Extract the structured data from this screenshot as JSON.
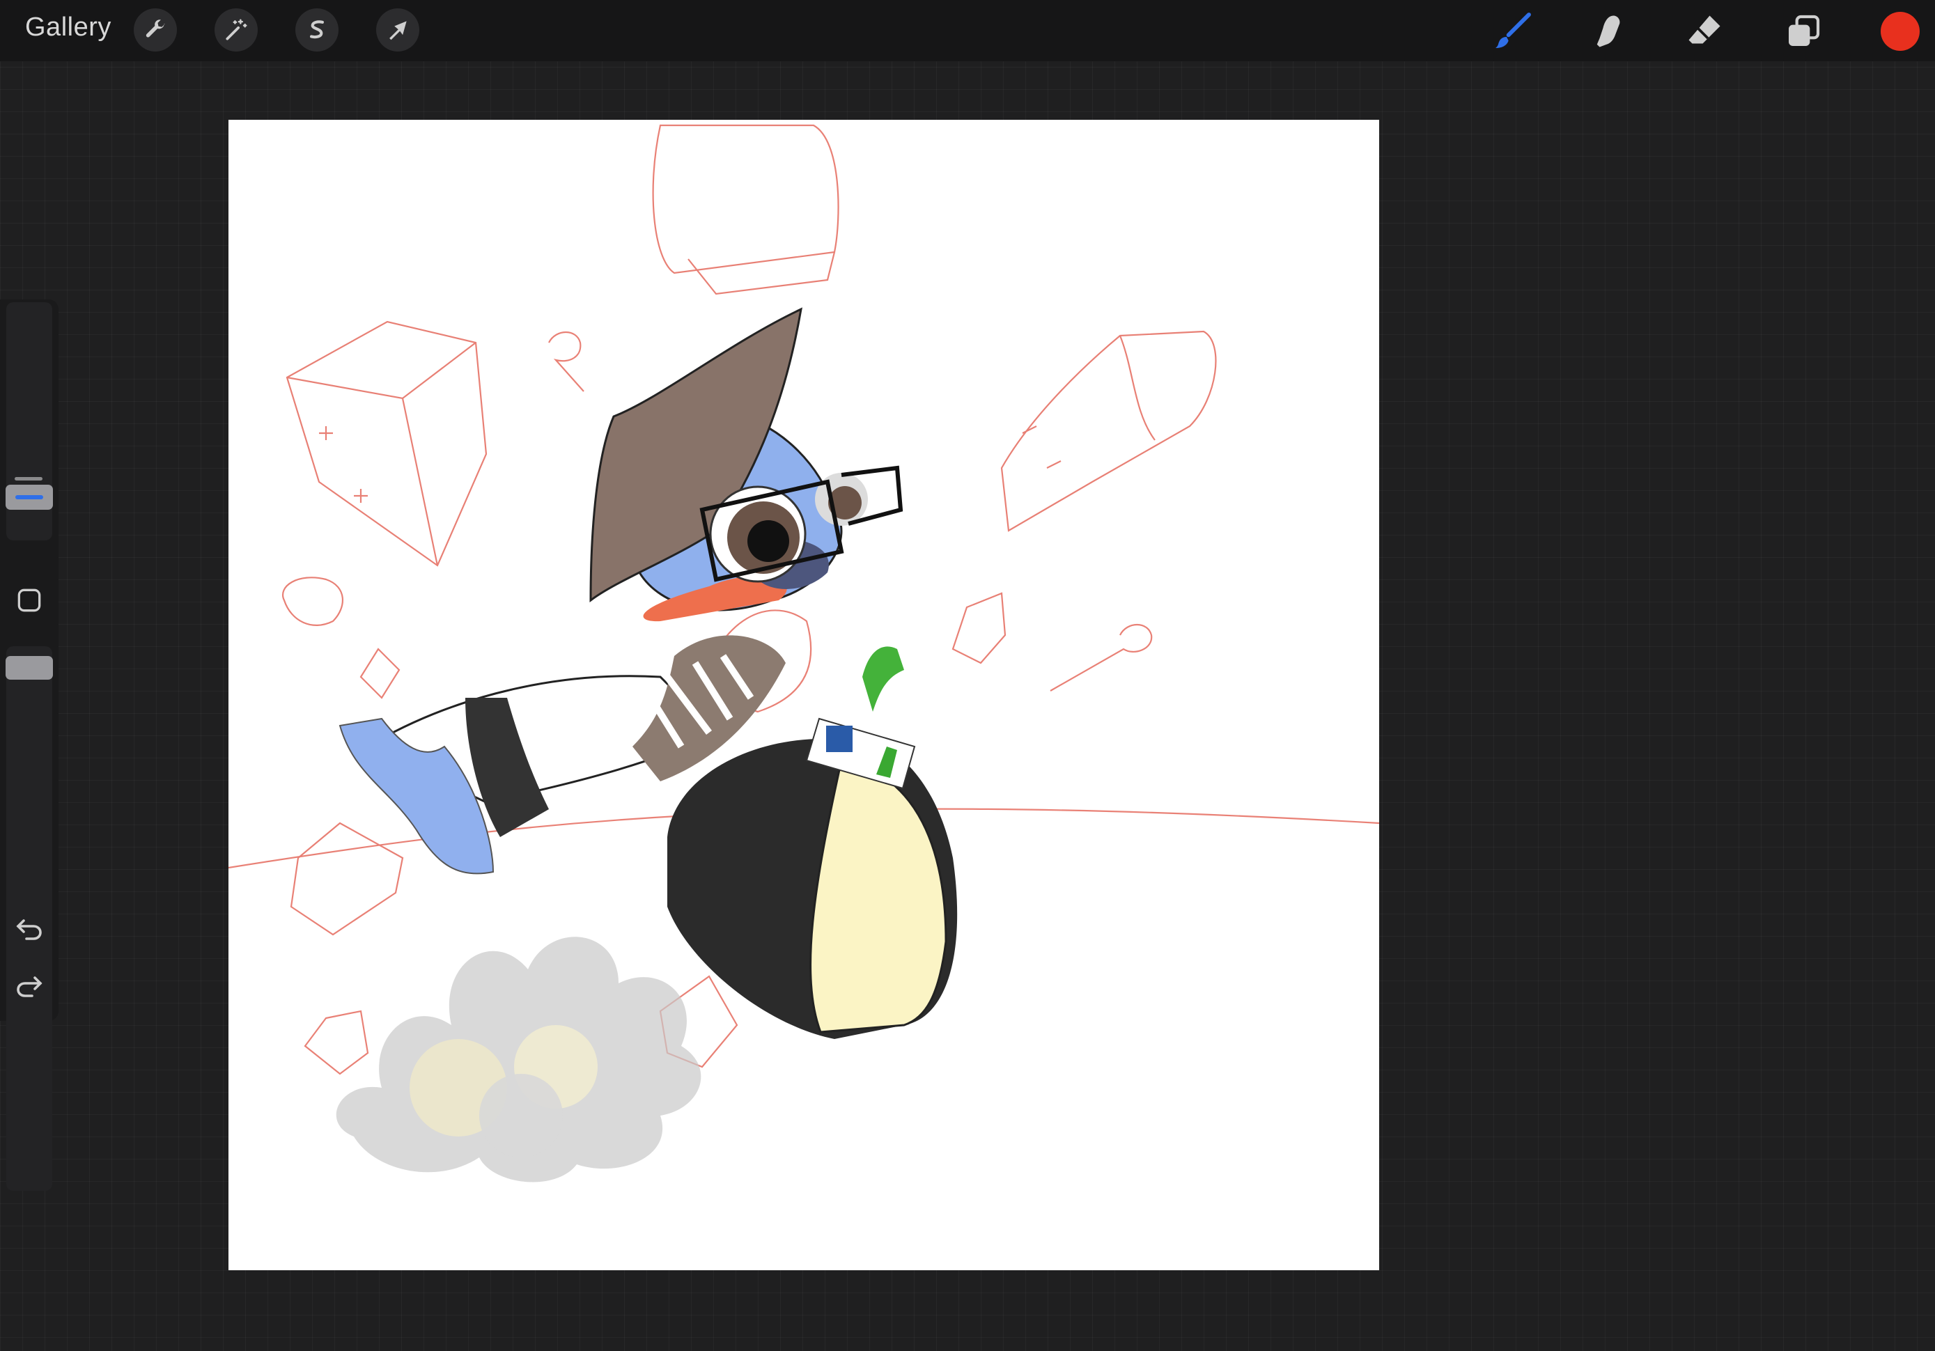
{
  "topbar": {
    "gallery_label": "Gallery",
    "left_tools": [
      {
        "name": "actions",
        "icon": "wrench-icon"
      },
      {
        "name": "adjustments",
        "icon": "magic-wand-icon"
      },
      {
        "name": "selection",
        "icon": "selection-s-icon"
      },
      {
        "name": "transform",
        "icon": "arrow-cursor-icon"
      }
    ],
    "right_tools": [
      {
        "name": "brush",
        "icon": "brush-icon",
        "active": true
      },
      {
        "name": "smudge",
        "icon": "smudge-finger-icon"
      },
      {
        "name": "eraser",
        "icon": "eraser-icon"
      },
      {
        "name": "layers",
        "icon": "layers-icon"
      }
    ],
    "active_color": "#e8301e",
    "accent_color": "#2f6fe8"
  },
  "sidebar": {
    "brush_size_level": 0.42,
    "opacity_level": 0.88,
    "modify_button_icon": "square-modify-icon",
    "undo_icon": "undo-icon",
    "redo_icon": "redo-icon"
  },
  "canvas": {
    "artwork_subject": "duck-character-illustration",
    "background": "#ffffff"
  }
}
